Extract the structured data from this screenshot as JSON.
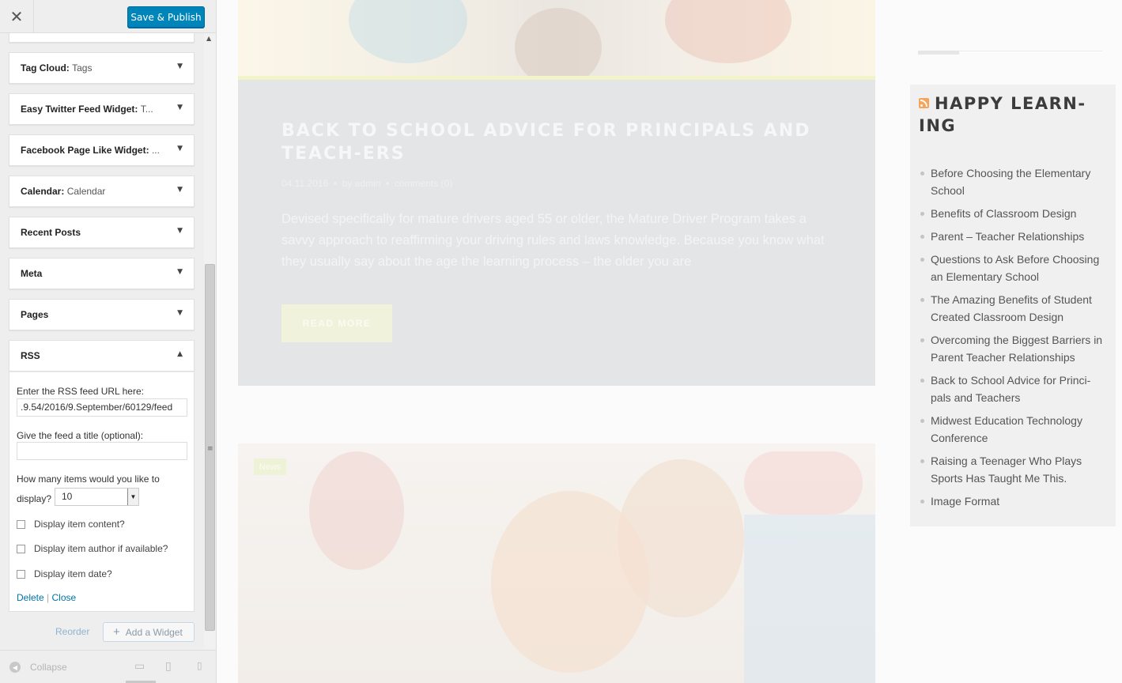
{
  "customizer": {
    "close_icon": "close-icon",
    "save_button": "Save & Publish",
    "widgets": [
      {
        "name": "Tag Cloud",
        "subtitle": "Tags"
      },
      {
        "name": "Easy Twitter Feed Widget",
        "subtitle": "T..."
      },
      {
        "name": "Facebook Page Like Widget",
        "subtitle": "..."
      },
      {
        "name": "Calendar",
        "subtitle": "Calendar"
      },
      {
        "name": "Recent Posts",
        "subtitle": ""
      },
      {
        "name": "Meta",
        "subtitle": ""
      },
      {
        "name": "Pages",
        "subtitle": ""
      },
      {
        "name": "RSS",
        "subtitle": ""
      }
    ],
    "rss_form": {
      "url_label": "Enter the RSS feed URL here:",
      "url_value": ".9.54/2016/9.September/60129/feed",
      "title_label": "Give the feed a title (optional):",
      "title_value": "",
      "items_label_1": "How many items would you like to",
      "items_label_2": "display?",
      "items_value": "10",
      "checkbox_content": "Display item content?",
      "checkbox_author": "Display item author if available?",
      "checkbox_date": "Display item date?",
      "delete_link": "Delete",
      "separator": "|",
      "close_link": "Close"
    },
    "reorder": "Reorder",
    "add_widget": "Add a Widget",
    "collapse": "Collapse"
  },
  "preview": {
    "post": {
      "title": "BACK TO SCHOOL ADVICE FOR PRINCIPALS AND TEACH-ERS",
      "date": "04.11.2016",
      "by": "by",
      "author": "admin",
      "comments": "comments (0)",
      "excerpt": "Devised specifically for mature drivers aged 55 or older, the Mature Driver Program takes a savvy approach to reaffirming your driving rules and laws knowledge. Because you know what they usually say about the age the learning process – the older you are",
      "read_more": "READ MORE"
    },
    "post2_tag": "News",
    "sidebar_widget": {
      "title": "HAPPY LEARN-ING",
      "items": [
        "Before Choosing the Elementary School",
        "Benefits of Classroom Design",
        "Parent – Teacher Relationships",
        "Questions to Ask Before Choosing an Elementary School",
        "The Amazing Benefits of Student Created Classroom Design",
        "Overcoming the Biggest Barriers in Parent Teacher Relationships",
        "Back to School Advice for Princi-pals and Teachers",
        "Midwest Education Technology Conference",
        "Raising a Teenager Who Plays Sports Has Taught Me This.",
        "Image Format"
      ]
    }
  }
}
